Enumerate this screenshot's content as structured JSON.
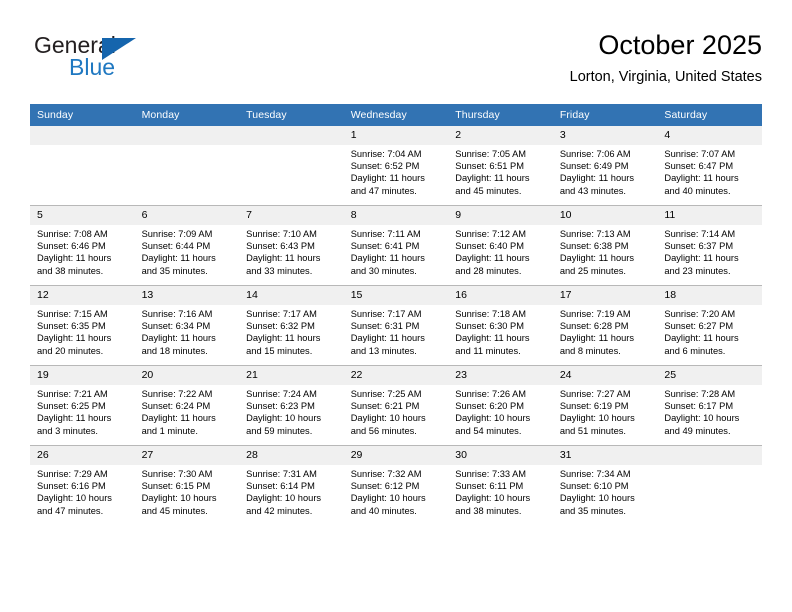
{
  "brand": {
    "name_part1": "General",
    "name_part2": "Blue",
    "triangle_color": "#1565ad",
    "blue_color": "#1f78c1"
  },
  "header": {
    "title": "October 2025",
    "subtitle": "Lorton, Virginia, United States",
    "header_bg": "#3273b3",
    "daynum_bg": "#f0f0f0"
  },
  "weekdays": [
    "Sunday",
    "Monday",
    "Tuesday",
    "Wednesday",
    "Thursday",
    "Friday",
    "Saturday"
  ],
  "labels": {
    "sunrise": "Sunrise:",
    "sunset": "Sunset:",
    "daylight": "Daylight:"
  },
  "weeks": [
    [
      {
        "day": "",
        "empty": true
      },
      {
        "day": "",
        "empty": true
      },
      {
        "day": "",
        "empty": true
      },
      {
        "day": "1",
        "sunrise": "Sunrise: 7:04 AM",
        "sunset": "Sunset: 6:52 PM",
        "daylight_1": "Daylight: 11 hours",
        "daylight_2": "and 47 minutes."
      },
      {
        "day": "2",
        "sunrise": "Sunrise: 7:05 AM",
        "sunset": "Sunset: 6:51 PM",
        "daylight_1": "Daylight: 11 hours",
        "daylight_2": "and 45 minutes."
      },
      {
        "day": "3",
        "sunrise": "Sunrise: 7:06 AM",
        "sunset": "Sunset: 6:49 PM",
        "daylight_1": "Daylight: 11 hours",
        "daylight_2": "and 43 minutes."
      },
      {
        "day": "4",
        "sunrise": "Sunrise: 7:07 AM",
        "sunset": "Sunset: 6:47 PM",
        "daylight_1": "Daylight: 11 hours",
        "daylight_2": "and 40 minutes."
      }
    ],
    [
      {
        "day": "5",
        "sunrise": "Sunrise: 7:08 AM",
        "sunset": "Sunset: 6:46 PM",
        "daylight_1": "Daylight: 11 hours",
        "daylight_2": "and 38 minutes."
      },
      {
        "day": "6",
        "sunrise": "Sunrise: 7:09 AM",
        "sunset": "Sunset: 6:44 PM",
        "daylight_1": "Daylight: 11 hours",
        "daylight_2": "and 35 minutes."
      },
      {
        "day": "7",
        "sunrise": "Sunrise: 7:10 AM",
        "sunset": "Sunset: 6:43 PM",
        "daylight_1": "Daylight: 11 hours",
        "daylight_2": "and 33 minutes."
      },
      {
        "day": "8",
        "sunrise": "Sunrise: 7:11 AM",
        "sunset": "Sunset: 6:41 PM",
        "daylight_1": "Daylight: 11 hours",
        "daylight_2": "and 30 minutes."
      },
      {
        "day": "9",
        "sunrise": "Sunrise: 7:12 AM",
        "sunset": "Sunset: 6:40 PM",
        "daylight_1": "Daylight: 11 hours",
        "daylight_2": "and 28 minutes."
      },
      {
        "day": "10",
        "sunrise": "Sunrise: 7:13 AM",
        "sunset": "Sunset: 6:38 PM",
        "daylight_1": "Daylight: 11 hours",
        "daylight_2": "and 25 minutes."
      },
      {
        "day": "11",
        "sunrise": "Sunrise: 7:14 AM",
        "sunset": "Sunset: 6:37 PM",
        "daylight_1": "Daylight: 11 hours",
        "daylight_2": "and 23 minutes."
      }
    ],
    [
      {
        "day": "12",
        "sunrise": "Sunrise: 7:15 AM",
        "sunset": "Sunset: 6:35 PM",
        "daylight_1": "Daylight: 11 hours",
        "daylight_2": "and 20 minutes."
      },
      {
        "day": "13",
        "sunrise": "Sunrise: 7:16 AM",
        "sunset": "Sunset: 6:34 PM",
        "daylight_1": "Daylight: 11 hours",
        "daylight_2": "and 18 minutes."
      },
      {
        "day": "14",
        "sunrise": "Sunrise: 7:17 AM",
        "sunset": "Sunset: 6:32 PM",
        "daylight_1": "Daylight: 11 hours",
        "daylight_2": "and 15 minutes."
      },
      {
        "day": "15",
        "sunrise": "Sunrise: 7:17 AM",
        "sunset": "Sunset: 6:31 PM",
        "daylight_1": "Daylight: 11 hours",
        "daylight_2": "and 13 minutes."
      },
      {
        "day": "16",
        "sunrise": "Sunrise: 7:18 AM",
        "sunset": "Sunset: 6:30 PM",
        "daylight_1": "Daylight: 11 hours",
        "daylight_2": "and 11 minutes."
      },
      {
        "day": "17",
        "sunrise": "Sunrise: 7:19 AM",
        "sunset": "Sunset: 6:28 PM",
        "daylight_1": "Daylight: 11 hours",
        "daylight_2": "and 8 minutes."
      },
      {
        "day": "18",
        "sunrise": "Sunrise: 7:20 AM",
        "sunset": "Sunset: 6:27 PM",
        "daylight_1": "Daylight: 11 hours",
        "daylight_2": "and 6 minutes."
      }
    ],
    [
      {
        "day": "19",
        "sunrise": "Sunrise: 7:21 AM",
        "sunset": "Sunset: 6:25 PM",
        "daylight_1": "Daylight: 11 hours",
        "daylight_2": "and 3 minutes."
      },
      {
        "day": "20",
        "sunrise": "Sunrise: 7:22 AM",
        "sunset": "Sunset: 6:24 PM",
        "daylight_1": "Daylight: 11 hours",
        "daylight_2": "and 1 minute."
      },
      {
        "day": "21",
        "sunrise": "Sunrise: 7:24 AM",
        "sunset": "Sunset: 6:23 PM",
        "daylight_1": "Daylight: 10 hours",
        "daylight_2": "and 59 minutes."
      },
      {
        "day": "22",
        "sunrise": "Sunrise: 7:25 AM",
        "sunset": "Sunset: 6:21 PM",
        "daylight_1": "Daylight: 10 hours",
        "daylight_2": "and 56 minutes."
      },
      {
        "day": "23",
        "sunrise": "Sunrise: 7:26 AM",
        "sunset": "Sunset: 6:20 PM",
        "daylight_1": "Daylight: 10 hours",
        "daylight_2": "and 54 minutes."
      },
      {
        "day": "24",
        "sunrise": "Sunrise: 7:27 AM",
        "sunset": "Sunset: 6:19 PM",
        "daylight_1": "Daylight: 10 hours",
        "daylight_2": "and 51 minutes."
      },
      {
        "day": "25",
        "sunrise": "Sunrise: 7:28 AM",
        "sunset": "Sunset: 6:17 PM",
        "daylight_1": "Daylight: 10 hours",
        "daylight_2": "and 49 minutes."
      }
    ],
    [
      {
        "day": "26",
        "sunrise": "Sunrise: 7:29 AM",
        "sunset": "Sunset: 6:16 PM",
        "daylight_1": "Daylight: 10 hours",
        "daylight_2": "and 47 minutes."
      },
      {
        "day": "27",
        "sunrise": "Sunrise: 7:30 AM",
        "sunset": "Sunset: 6:15 PM",
        "daylight_1": "Daylight: 10 hours",
        "daylight_2": "and 45 minutes."
      },
      {
        "day": "28",
        "sunrise": "Sunrise: 7:31 AM",
        "sunset": "Sunset: 6:14 PM",
        "daylight_1": "Daylight: 10 hours",
        "daylight_2": "and 42 minutes."
      },
      {
        "day": "29",
        "sunrise": "Sunrise: 7:32 AM",
        "sunset": "Sunset: 6:12 PM",
        "daylight_1": "Daylight: 10 hours",
        "daylight_2": "and 40 minutes."
      },
      {
        "day": "30",
        "sunrise": "Sunrise: 7:33 AM",
        "sunset": "Sunset: 6:11 PM",
        "daylight_1": "Daylight: 10 hours",
        "daylight_2": "and 38 minutes."
      },
      {
        "day": "31",
        "sunrise": "Sunrise: 7:34 AM",
        "sunset": "Sunset: 6:10 PM",
        "daylight_1": "Daylight: 10 hours",
        "daylight_2": "and 35 minutes."
      },
      {
        "day": "",
        "empty": true
      }
    ]
  ]
}
